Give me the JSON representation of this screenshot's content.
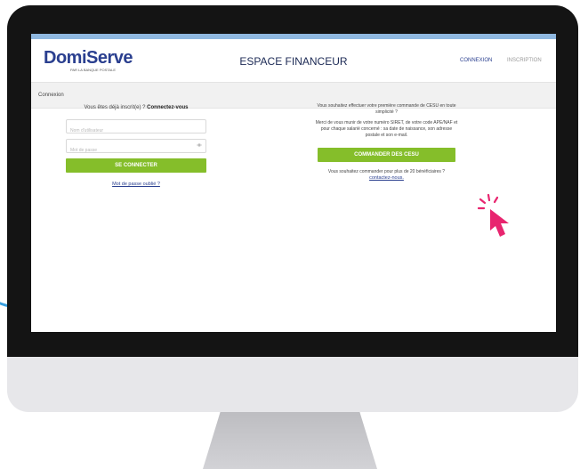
{
  "header": {
    "logo_main": "DomiServe",
    "logo_sub": "PAR LA BANQUE POSTALE",
    "title": "ESPACE FINANCEUR",
    "nav_login": "CONNEXION",
    "nav_signup": "INSCRIPTION"
  },
  "breadcrumb": "Connexion",
  "login": {
    "prompt_prefix": "Vous êtes déjà inscrit(e) ? ",
    "prompt_bold": "Connectez-vous",
    "username_placeholder": "Nom d'utilisateur",
    "password_placeholder": "Mot de passe",
    "submit_label": "SE CONNECTER",
    "forgot_label": "Mot de passe oublié ?"
  },
  "order": {
    "intro": "Vous souhaitez effectuer votre première commande de CESU en toute simplicité ?",
    "instructions": "Merci de vous munir de votre numéro SIRET, de votre code APE/NAF et pour chaque salarié concerné : sa date de naissance, son adresse postale et son e-mail.",
    "button_label": "COMMANDER DES CESU",
    "bulk_text": "Vous souhaitez commander pour plus de 20 bénéficiaires ?",
    "contact_link": "contactez-nous."
  },
  "colors": {
    "brand_blue": "#2a3f8f",
    "button_green": "#85be2a",
    "cursor_pink": "#e8256f",
    "logo_accent": "#e0a020"
  },
  "icons": {
    "password_toggle": "eye-icon",
    "pointer": "hand-cursor-icon"
  }
}
